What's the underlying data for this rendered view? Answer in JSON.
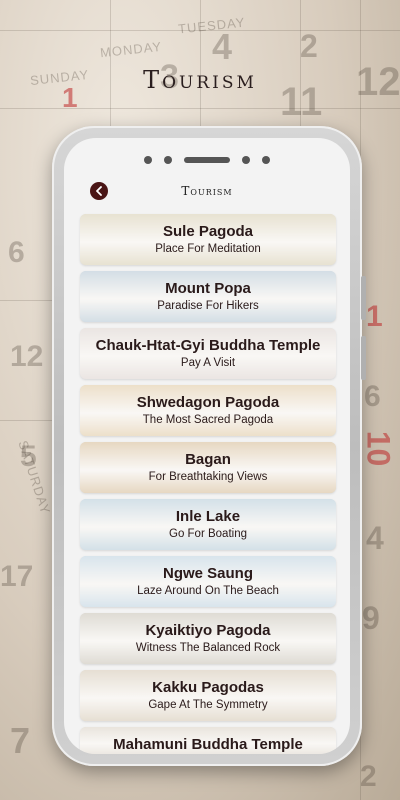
{
  "header": {
    "title": "Tourism"
  },
  "screen": {
    "title": "Tourism"
  },
  "background_numbers": [
    "1",
    "3",
    "4",
    "2",
    "11",
    "12",
    "6",
    "12",
    "5",
    "17",
    "6",
    "4",
    "10",
    "9",
    "7",
    "2",
    "1"
  ],
  "background_days": [
    "MONDAY",
    "TUESDAY",
    "SUNDAY",
    "SATURDAY"
  ],
  "places": [
    {
      "name": "Sule Pagoda",
      "tagline": "Place For Meditation",
      "tone": "#cbbf9a"
    },
    {
      "name": "Mount Popa",
      "tagline": "Paradise For Hikers",
      "tone": "#9fb6c6"
    },
    {
      "name": "Chauk-Htat-Gyi Buddha Temple",
      "tagline": "Pay A Visit",
      "tone": "#d2c6c0"
    },
    {
      "name": "Shwedagon Pagoda",
      "tagline": "The Most Sacred Pagoda",
      "tone": "#d6b98a"
    },
    {
      "name": "Bagan",
      "tagline": "For Breathtaking Views",
      "tone": "#c9a878"
    },
    {
      "name": "Inle Lake",
      "tagline": "Go For Boating",
      "tone": "#9fbccc"
    },
    {
      "name": "Ngwe Saung",
      "tagline": "Laze Around On The Beach",
      "tone": "#a9c4d6"
    },
    {
      "name": "Kyaiktiyo Pagoda",
      "tagline": "Witness The Balanced Rock",
      "tone": "#b7b0a0"
    },
    {
      "name": "Kakku Pagodas",
      "tagline": "Gape At The Symmetry",
      "tone": "#c8b89e"
    },
    {
      "name": "Mahamuni Buddha Temple",
      "tagline": "",
      "tone": "#cfc4b4"
    }
  ],
  "colors": {
    "accent": "#4a1515",
    "text": "#2a1a1a"
  }
}
